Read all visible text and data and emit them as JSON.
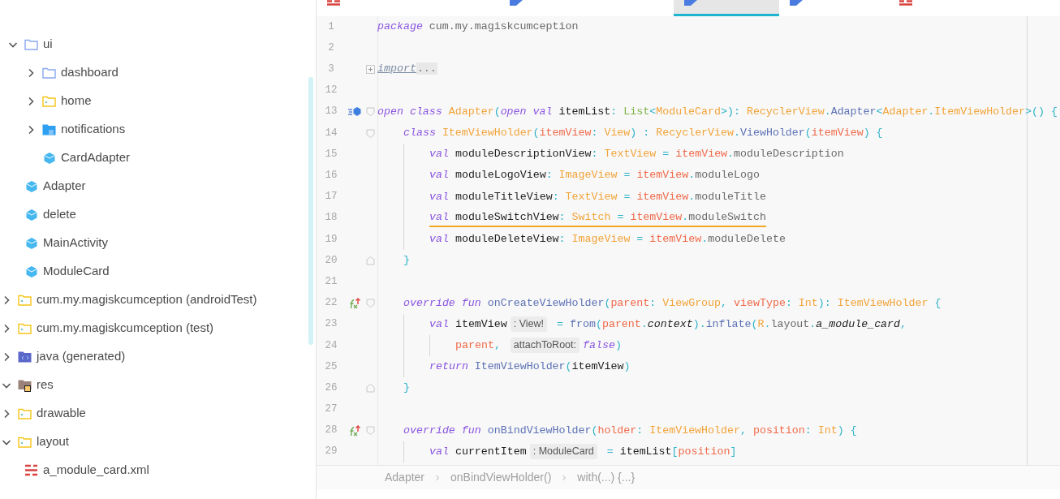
{
  "project_tree": [
    {
      "children": [
        {
          "children": [
            {
              "label": "ui",
              "kind": "folder",
              "expanded": true,
              "children": [
                {
                  "label": "dashboard",
                  "kind": "folder",
                  "expanded": false
                },
                {
                  "label": "home",
                  "kind": "package",
                  "expanded": false
                },
                {
                  "label": "notifications",
                  "kind": "filled-folder",
                  "expanded": false
                },
                {
                  "label": "CardAdapter",
                  "kind": "class"
                }
              ]
            },
            {
              "label": "Adapter",
              "kind": "class"
            },
            {
              "label": "delete",
              "kind": "class"
            },
            {
              "label": "MainActivity",
              "kind": "class"
            },
            {
              "label": "ModuleCard",
              "kind": "class"
            }
          ]
        },
        {
          "label": "cum.my.magiskcumception (androidTest)",
          "kind": "package",
          "expanded": false
        },
        {
          "label": "cum.my.magiskcumception (test)",
          "kind": "package",
          "expanded": false
        }
      ]
    },
    {
      "label": "java (generated)",
      "kind": "generated",
      "expanded": false
    },
    {
      "label": "res",
      "kind": "resources",
      "expanded": true,
      "children": [
        {
          "label": "drawable",
          "kind": "package",
          "expanded": false
        },
        {
          "label": "layout",
          "kind": "package",
          "expanded": true,
          "children": [
            {
              "label": "a_module_card.xml",
              "kind": "layout"
            }
          ]
        }
      ]
    }
  ],
  "editor_tabs": [
    {
      "kind": "xml",
      "selected": false
    },
    {
      "kind": "kotlin",
      "selected": false
    },
    {
      "kind": "kotlin",
      "selected": true
    },
    {
      "kind": "kotlin",
      "selected": false
    },
    {
      "kind": "xml",
      "selected": false
    }
  ],
  "code_lines": [
    {
      "number": "1",
      "tokens": [
        {
          "kind": "kw",
          "text": "package "
        },
        {
          "kind": "member",
          "text": "cum.my.magiskcumception"
        }
      ]
    },
    {
      "number": "2"
    },
    {
      "number": "3",
      "folded": true,
      "tokens": [
        {
          "kind": "link",
          "text": "import"
        },
        {
          "kind": "folded",
          "text": "..."
        }
      ]
    },
    {
      "number": "12"
    },
    {
      "number": "13",
      "implements_marker": true,
      "fold_start": true,
      "tokens": [
        {
          "kind": "kw",
          "text": "open "
        },
        {
          "kind": "kw",
          "text": "class "
        },
        {
          "kind": "type",
          "text": "Adapter"
        },
        {
          "kind": "punct",
          "text": "("
        },
        {
          "kind": "kw",
          "text": "open "
        },
        {
          "kind": "kw",
          "text": "val "
        },
        {
          "kind": "plain",
          "text": "itemList"
        },
        {
          "kind": "punct",
          "text": ": "
        },
        {
          "kind": "generic",
          "text": "List"
        },
        {
          "kind": "punct",
          "text": "<"
        },
        {
          "kind": "type",
          "text": "ModuleCard"
        },
        {
          "kind": "punct",
          "text": ">): "
        },
        {
          "kind": "type",
          "text": "RecyclerView"
        },
        {
          "kind": "punct",
          "text": "."
        },
        {
          "kind": "ref",
          "text": "Adapter"
        },
        {
          "kind": "punct",
          "text": "<"
        },
        {
          "kind": "type",
          "text": "Adapter"
        },
        {
          "kind": "punct",
          "text": "."
        },
        {
          "kind": "type",
          "text": "ItemViewHolder"
        },
        {
          "kind": "punct",
          "text": ">() {"
        }
      ],
      "children": [
        {
          "number": "14",
          "fold_start": true,
          "tokens": [
            {
              "kind": "kw",
              "text": "class "
            },
            {
              "kind": "type",
              "text": "ItemViewHolder"
            },
            {
              "kind": "punct",
              "text": "("
            },
            {
              "kind": "param",
              "text": "itemView"
            },
            {
              "kind": "punct",
              "text": ": "
            },
            {
              "kind": "type",
              "text": "View"
            },
            {
              "kind": "punct",
              "text": ") : "
            },
            {
              "kind": "type",
              "text": "RecyclerView"
            },
            {
              "kind": "punct",
              "text": "."
            },
            {
              "kind": "ref",
              "text": "ViewHolder"
            },
            {
              "kind": "punct",
              "text": "("
            },
            {
              "kind": "param",
              "text": "itemView"
            },
            {
              "kind": "punct",
              "text": ") {"
            }
          ],
          "children": [
            {
              "number": "15",
              "tokens": [
                {
                  "kind": "kw",
                  "text": "val "
                },
                {
                  "kind": "plain",
                  "text": "moduleDescriptionView"
                },
                {
                  "kind": "punct",
                  "text": ": "
                },
                {
                  "kind": "type",
                  "text": "TextView"
                },
                {
                  "kind": "punct",
                  "text": " = "
                },
                {
                  "kind": "param",
                  "text": "itemView"
                },
                {
                  "kind": "punct",
                  "text": "."
                },
                {
                  "kind": "member",
                  "text": "moduleDescription"
                }
              ]
            },
            {
              "number": "16",
              "tokens": [
                {
                  "kind": "kw",
                  "text": "val "
                },
                {
                  "kind": "plain",
                  "text": "moduleLogoView"
                },
                {
                  "kind": "punct",
                  "text": ": "
                },
                {
                  "kind": "type",
                  "text": "ImageView"
                },
                {
                  "kind": "punct",
                  "text": " = "
                },
                {
                  "kind": "param",
                  "text": "itemView"
                },
                {
                  "kind": "punct",
                  "text": "."
                },
                {
                  "kind": "member",
                  "text": "moduleLogo"
                }
              ]
            },
            {
              "number": "17",
              "tokens": [
                {
                  "kind": "kw",
                  "text": "val "
                },
                {
                  "kind": "plain",
                  "text": "moduleTitleView"
                },
                {
                  "kind": "punct",
                  "text": ": "
                },
                {
                  "kind": "type",
                  "text": "TextView"
                },
                {
                  "kind": "punct",
                  "text": " = "
                },
                {
                  "kind": "param",
                  "text": "itemView"
                },
                {
                  "kind": "punct",
                  "text": "."
                },
                {
                  "kind": "member",
                  "text": "moduleTitle"
                }
              ]
            },
            {
              "number": "18",
              "warning": true,
              "tokens": [
                {
                  "kind": "kw",
                  "text": "val "
                },
                {
                  "kind": "plain",
                  "text": "moduleSwitchView"
                },
                {
                  "kind": "punct",
                  "text": ": "
                },
                {
                  "kind": "type",
                  "text": "Switch"
                },
                {
                  "kind": "punct",
                  "text": " = "
                },
                {
                  "kind": "param",
                  "text": "itemView"
                },
                {
                  "kind": "punct",
                  "text": "."
                },
                {
                  "kind": "member",
                  "text": "moduleSwitch"
                }
              ]
            },
            {
              "number": "19",
              "tokens": [
                {
                  "kind": "kw",
                  "text": "val "
                },
                {
                  "kind": "plain",
                  "text": "moduleDeleteView"
                },
                {
                  "kind": "punct",
                  "text": ": "
                },
                {
                  "kind": "type",
                  "text": "ImageView"
                },
                {
                  "kind": "punct",
                  "text": " = "
                },
                {
                  "kind": "param",
                  "text": "itemView"
                },
                {
                  "kind": "punct",
                  "text": "."
                },
                {
                  "kind": "member",
                  "text": "moduleDelete"
                }
              ]
            }
          ]
        },
        {
          "number": "20",
          "fold_end": true,
          "tokens": [
            {
              "kind": "punct",
              "text": "}"
            }
          ]
        },
        {
          "number": "21"
        },
        {
          "number": "22",
          "override_marker": true,
          "fold_start": true,
          "tokens": [
            {
              "kind": "kw",
              "text": "override "
            },
            {
              "kind": "kw",
              "text": "fun "
            },
            {
              "kind": "ref",
              "text": "onCreateViewHolder"
            },
            {
              "kind": "punct",
              "text": "("
            },
            {
              "kind": "param",
              "text": "parent"
            },
            {
              "kind": "punct",
              "text": ": "
            },
            {
              "kind": "type",
              "text": "ViewGroup"
            },
            {
              "kind": "punct",
              "text": ", "
            },
            {
              "kind": "param",
              "text": "viewType"
            },
            {
              "kind": "punct",
              "text": ": "
            },
            {
              "kind": "type",
              "text": "Int"
            },
            {
              "kind": "punct",
              "text": "): "
            },
            {
              "kind": "type",
              "text": "ItemViewHolder"
            },
            {
              "kind": "punct",
              "text": " {"
            }
          ],
          "children": [
            {
              "number": "23",
              "tokens": [
                {
                  "kind": "kw",
                  "text": "val "
                },
                {
                  "kind": "plain",
                  "text": "itemView"
                },
                {
                  "kind": "hint",
                  "text": ": View!"
                },
                {
                  "kind": "punct",
                  "text": " = "
                },
                {
                  "kind": "ref",
                  "text": "from"
                },
                {
                  "kind": "punct",
                  "text": "("
                },
                {
                  "kind": "param",
                  "text": "parent"
                },
                {
                  "kind": "punct",
                  "text": "."
                },
                {
                  "kind": "italic",
                  "text": "context"
                },
                {
                  "kind": "punct",
                  "text": ")."
                },
                {
                  "kind": "ref",
                  "text": "inflate"
                },
                {
                  "kind": "punct",
                  "text": "("
                },
                {
                  "kind": "type",
                  "text": "R"
                },
                {
                  "kind": "punct",
                  "text": "."
                },
                {
                  "kind": "member",
                  "text": "layout"
                },
                {
                  "kind": "punct",
                  "text": "."
                },
                {
                  "kind": "italic",
                  "text": "a_module_card"
                },
                {
                  "kind": "punct",
                  "text": ","
                }
              ],
              "children": [
                {
                  "number": "24",
                  "tokens": [
                    {
                      "kind": "param",
                      "text": "parent"
                    },
                    {
                      "kind": "punct",
                      "text": ", "
                    },
                    {
                      "kind": "hint",
                      "text": "attachToRoot:"
                    },
                    {
                      "kind": "kw",
                      "text": "false"
                    },
                    {
                      "kind": "punct",
                      "text": ")"
                    }
                  ]
                }
              ]
            },
            {
              "number": "25",
              "tokens": [
                {
                  "kind": "kw",
                  "text": "return "
                },
                {
                  "kind": "ref",
                  "text": "ItemViewHolder"
                },
                {
                  "kind": "punct",
                  "text": "("
                },
                {
                  "kind": "plain",
                  "text": "itemView"
                },
                {
                  "kind": "punct",
                  "text": ")"
                }
              ]
            }
          ]
        },
        {
          "number": "26",
          "fold_end": true,
          "tokens": [
            {
              "kind": "punct",
              "text": "}"
            }
          ]
        },
        {
          "number": "27"
        },
        {
          "number": "28",
          "override_marker": true,
          "fold_start": true,
          "tokens": [
            {
              "kind": "kw",
              "text": "override "
            },
            {
              "kind": "kw",
              "text": "fun "
            },
            {
              "kind": "ref",
              "text": "onBindViewHolder"
            },
            {
              "kind": "punct",
              "text": "("
            },
            {
              "kind": "param",
              "text": "holder"
            },
            {
              "kind": "punct",
              "text": ": "
            },
            {
              "kind": "type",
              "text": "ItemViewHolder"
            },
            {
              "kind": "punct",
              "text": ", "
            },
            {
              "kind": "param",
              "text": "position"
            },
            {
              "kind": "punct",
              "text": ": "
            },
            {
              "kind": "type",
              "text": "Int"
            },
            {
              "kind": "punct",
              "text": ") {"
            }
          ],
          "children": [
            {
              "number": "29",
              "tokens": [
                {
                  "kind": "kw",
                  "text": "val "
                },
                {
                  "kind": "plain",
                  "text": "currentItem"
                },
                {
                  "kind": "hint",
                  "text": ": ModuleCard"
                },
                {
                  "kind": "punct",
                  "text": " = "
                },
                {
                  "kind": "plain",
                  "text": "itemList"
                },
                {
                  "kind": "punct",
                  "text": "["
                },
                {
                  "kind": "param",
                  "text": "position"
                },
                {
                  "kind": "punct",
                  "text": "]"
                }
              ]
            }
          ]
        }
      ]
    }
  ],
  "breadcrumbs": [
    "Adapter",
    "onBindViewHolder()",
    "with(...) {...}"
  ]
}
